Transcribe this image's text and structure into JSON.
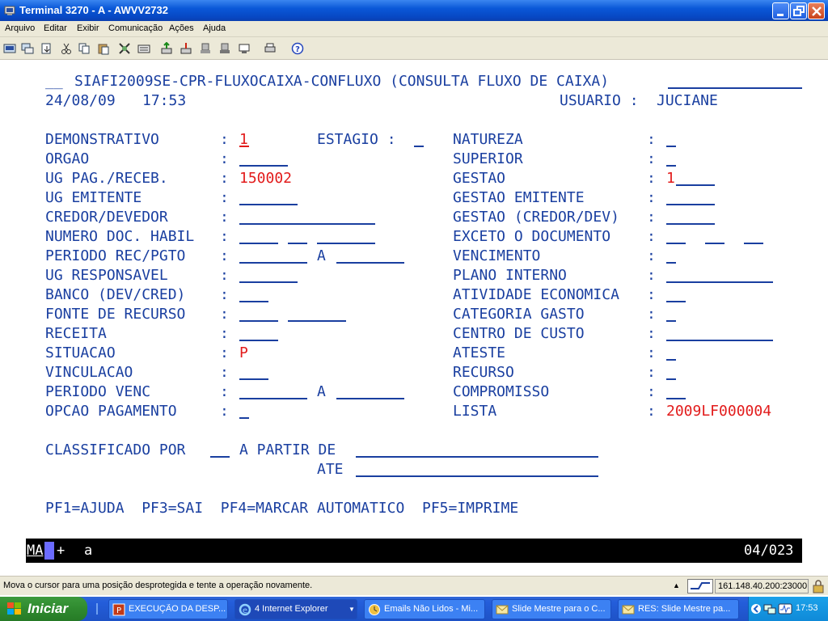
{
  "window": {
    "title": "Terminal 3270 - A - AWVV2732"
  },
  "menu": [
    "Arquivo",
    "Editar",
    "Exibir",
    "Comunicação",
    "Ações",
    "Ajuda"
  ],
  "screen": {
    "header_prefix": "__",
    "header_title": "SIAFI2009SE-CPR-FLUXOCAIXA-CONFLUXO (CONSULTA FLUXO DE CAIXA)",
    "date": "24/08/09",
    "time": "17:53",
    "user_label": "USUARIO :",
    "user_value": "JUCIANE",
    "left_fields": [
      {
        "label": "DEMONSTRATIVO",
        "value": "1"
      },
      {
        "label": "ORGAO",
        "value": ""
      },
      {
        "label": "UG PAG./RECEB.",
        "value": "150002"
      },
      {
        "label": "UG EMITENTE",
        "value": ""
      },
      {
        "label": "CREDOR/DEVEDOR",
        "value": ""
      },
      {
        "label": "NUMERO DOC. HABIL",
        "value": ""
      },
      {
        "label": "PERIODO REC/PGTO",
        "value": ""
      },
      {
        "label": "UG RESPONSAVEL",
        "value": ""
      },
      {
        "label": "BANCO (DEV/CRED)",
        "value": ""
      },
      {
        "label": "FONTE DE RECURSO",
        "value": ""
      },
      {
        "label": "RECEITA",
        "value": ""
      },
      {
        "label": "SITUACAO",
        "value": "P"
      },
      {
        "label": "VINCULACAO",
        "value": ""
      },
      {
        "label": "PERIODO VENC",
        "value": ""
      },
      {
        "label": "OPCAO PAGAMENTO",
        "value": ""
      }
    ],
    "estagio_label": "ESTAGIO :",
    "between_a": "A",
    "right_fields": [
      {
        "label": "NATUREZA",
        "value": ""
      },
      {
        "label": "SUPERIOR",
        "value": ""
      },
      {
        "label": "GESTAO",
        "value": "1"
      },
      {
        "label": "GESTAO EMITENTE",
        "value": ""
      },
      {
        "label": "GESTAO (CREDOR/DEV)",
        "value": ""
      },
      {
        "label": "EXCETO O DOCUMENTO",
        "value": ""
      },
      {
        "label": "VENCIMENTO",
        "value": ""
      },
      {
        "label": "PLANO INTERNO",
        "value": ""
      },
      {
        "label": "ATIVIDADE ECONOMICA",
        "value": ""
      },
      {
        "label": "CATEGORIA GASTO",
        "value": ""
      },
      {
        "label": "CENTRO DE CUSTO",
        "value": ""
      },
      {
        "label": "ATESTE",
        "value": ""
      },
      {
        "label": "RECURSO",
        "value": ""
      },
      {
        "label": "COMPROMISSO",
        "value": ""
      },
      {
        "label": "LISTA",
        "value": "2009LF000004"
      }
    ],
    "colon": ":",
    "classificado_label": "CLASSIFICADO POR",
    "a_partir_label": "A PARTIR DE",
    "ate_label": "ATE",
    "pf_keys": "PF1=AJUDA  PF3=SAI  PF4=MARCAR AUTOMATICO  PF5=IMPRIME"
  },
  "oia": {
    "mode": "MA",
    "plus": "+",
    "indicator": "a",
    "cursor": "04/023"
  },
  "status": {
    "message": "Mova o cursor para uma posição desprotegida e tente a operação novamente.",
    "address": "161.148.40.200:23000"
  },
  "taskbar": {
    "start": "Iniciar",
    "tasks": [
      {
        "label": "EXECUÇÃO DA DESP..."
      },
      {
        "label": "4 Internet Explorer"
      },
      {
        "label": "Emails Não Lidos - Mi..."
      },
      {
        "label": "Slide Mestre para o C..."
      },
      {
        "label": "RES: Slide Mestre pa..."
      }
    ],
    "clock": "17:53"
  }
}
